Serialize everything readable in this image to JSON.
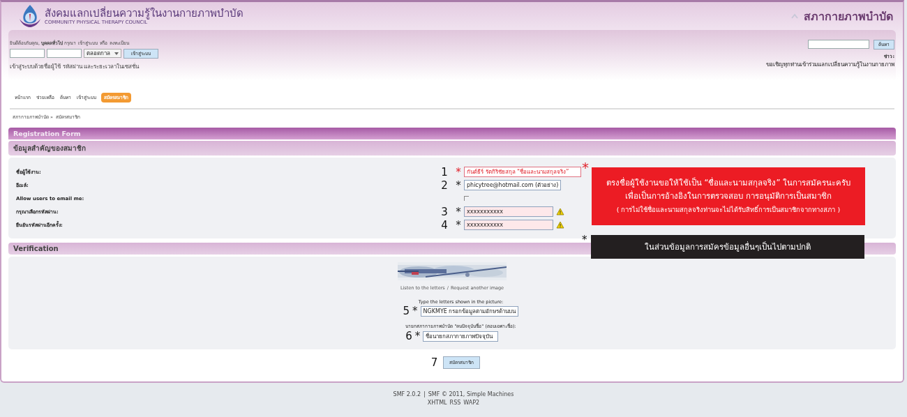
{
  "header": {
    "site_title": "สังคมแลกเปลี่ยนความรู้ในงานกายภาพบำบัด",
    "site_subtitle": "COMMUNITY PHYSICAL THERAPY COUNCIL",
    "forum_name": "สภากายภาพบำบัด"
  },
  "user_box": {
    "greeting": "ยินดีต้อนรับคุณ, **บุคคลทั่วไป** กรุณา",
    "login_link": "เข้าสู่ระบบ",
    "or_text": "หรือ",
    "register_link": "ลงทะเบียน",
    "session_select": "ตลอดกาล",
    "login_button": "เข้าสู่ระบบ",
    "hint": "เข้าสู่ระบบด้วยชื่อผู้ใช้ รหัสผ่าน และระยะเวลาในเซสชั่น"
  },
  "search": {
    "button": "ค้นหา",
    "news_label": "ข่าว:",
    "news_text": "ขอเชิญทุกท่านเข้าร่วมแลกเปลี่ยนความรู้ในงานกายภาพ"
  },
  "menu": [
    {
      "label": "หน้าแรก",
      "selected": false
    },
    {
      "label": "ช่วยเหลือ",
      "selected": false
    },
    {
      "label": "ค้นหา",
      "selected": false
    },
    {
      "label": "เข้าสู่ระบบ",
      "selected": false
    },
    {
      "label": "สมัครสมาชิก",
      "selected": true
    }
  ],
  "breadcrumb": [
    {
      "label": "สภากายภาพบำบัด »"
    },
    {
      "label": "สมัครสมาชิก"
    }
  ],
  "form_title": "Registration Form",
  "section_title": "ข้อมูลสำคัญของสมาชิก",
  "fields": [
    {
      "label": "ชื่อผู้ใช้งาน:",
      "number": "1",
      "asterisk": "*",
      "asterisk_red": true,
      "kind": "text",
      "example": true,
      "invalid": false,
      "value": "กันต์ธีร์ รัตกิริชัยสกุล “ชื่อและนามสกุลจริง”"
    },
    {
      "label": "อีเมล์:",
      "number": "2",
      "asterisk": "*",
      "asterisk_red": false,
      "kind": "text",
      "example": false,
      "invalid": false,
      "value": "phicytree@hotmail.com (ตัวอย่าง)"
    },
    {
      "label": "Allow users to email me:",
      "kind": "checkbox",
      "checked": false
    },
    {
      "label": "กรุณาเลือกรหัสผ่าน:",
      "number": "3",
      "asterisk": "*",
      "asterisk_red": false,
      "kind": "text",
      "example": false,
      "invalid": true,
      "value": "xxxxxxxxxxx"
    },
    {
      "label": "ยืนยันรหัสผ่านอีกครั้ง:",
      "number": "4",
      "asterisk": "*",
      "asterisk_red": false,
      "kind": "text",
      "example": false,
      "invalid": true,
      "value": "xxxxxxxxxxx"
    }
  ],
  "verification": {
    "title": "Verification",
    "listen_link": "Listen to the letters",
    "separator": "/",
    "request_link": "Request another image",
    "captcha_prompt": "Type the letters shown in the picture:",
    "captcha_number": "5",
    "captcha_asterisk": "*",
    "captcha_value": "NGKMYE กรอกข้อมูลตามอักษรด้านบน",
    "question": "นายกสภากายภาพบำบัด \"คนปัจจุบันชื่อ\" (ตอบเฉพาะชื่อ):",
    "question_number": "6",
    "question_asterisk": "*",
    "question_value": "ชื่อนายกสภากายภาพปัจจุบัน"
  },
  "submit": {
    "number": "7",
    "button": "สมัครสมาชิก"
  },
  "notes": [
    {
      "kind": "red",
      "asterisk": "*",
      "lines": [
        "ตรงชื่อผู้ใช้งานขอให้ใช้เป็น “ชื่อและนามสกุลจริง” ในการสมัครนะครับ",
        "เพื่อเป็นการอ้างอิงในการตรวจสอบ การอนุมัติการเป็นสมาชิก",
        "( การไม่ใช้ชื่อและนามสกุลจริงท่านจะไม่ได้รับสิทธิ์การเป็นสมาชิกจากทางสภา )"
      ]
    },
    {
      "kind": "dark",
      "asterisk": "*",
      "lines": [
        "ในส่วนข้อมูลการสมัครข้อมูลอื่นๆเป็นไปตามปกติ"
      ]
    }
  ],
  "footer": {
    "links": [
      "SMF 2.0.2",
      "SMF © 2011, Simple Machines"
    ],
    "separator": "|",
    "badges": [
      "XHTML",
      "RSS",
      "WAP2"
    ]
  }
}
